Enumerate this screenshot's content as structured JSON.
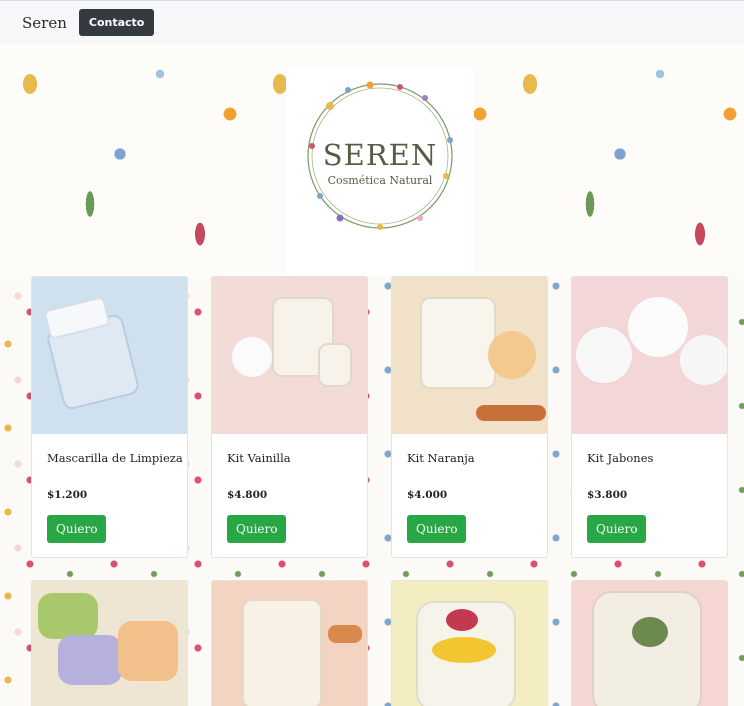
{
  "navbar": {
    "brand": "Seren",
    "contact_label": "Contacto"
  },
  "hero": {
    "logo_title": "SEREN",
    "logo_subtitle": "Cosmética Natural"
  },
  "buy_label": "Quiero",
  "products": [
    {
      "name": "Mascarilla de Limpieza",
      "price": "$1.200",
      "bg": "#cfe0ef"
    },
    {
      "name": "Kit Vainilla",
      "price": "$4.800",
      "bg": "#f3dcd8"
    },
    {
      "name": "Kit Naranja",
      "price": "$4.000",
      "bg": "#f1e1c8"
    },
    {
      "name": "Kit Jabones",
      "price": "$3.800",
      "bg": "#f2d6d8"
    }
  ],
  "products_row2": [
    {
      "bg": "#eee6d2"
    },
    {
      "bg": "#f3d4c2"
    },
    {
      "bg": "#f4edc2"
    },
    {
      "bg": "#f6d6d2"
    }
  ],
  "colors": {
    "navbar_bg": "#f6f7f8",
    "contact_button": "#343a40",
    "buy_button": "#28a745",
    "logo_text": "#5b5a46"
  }
}
